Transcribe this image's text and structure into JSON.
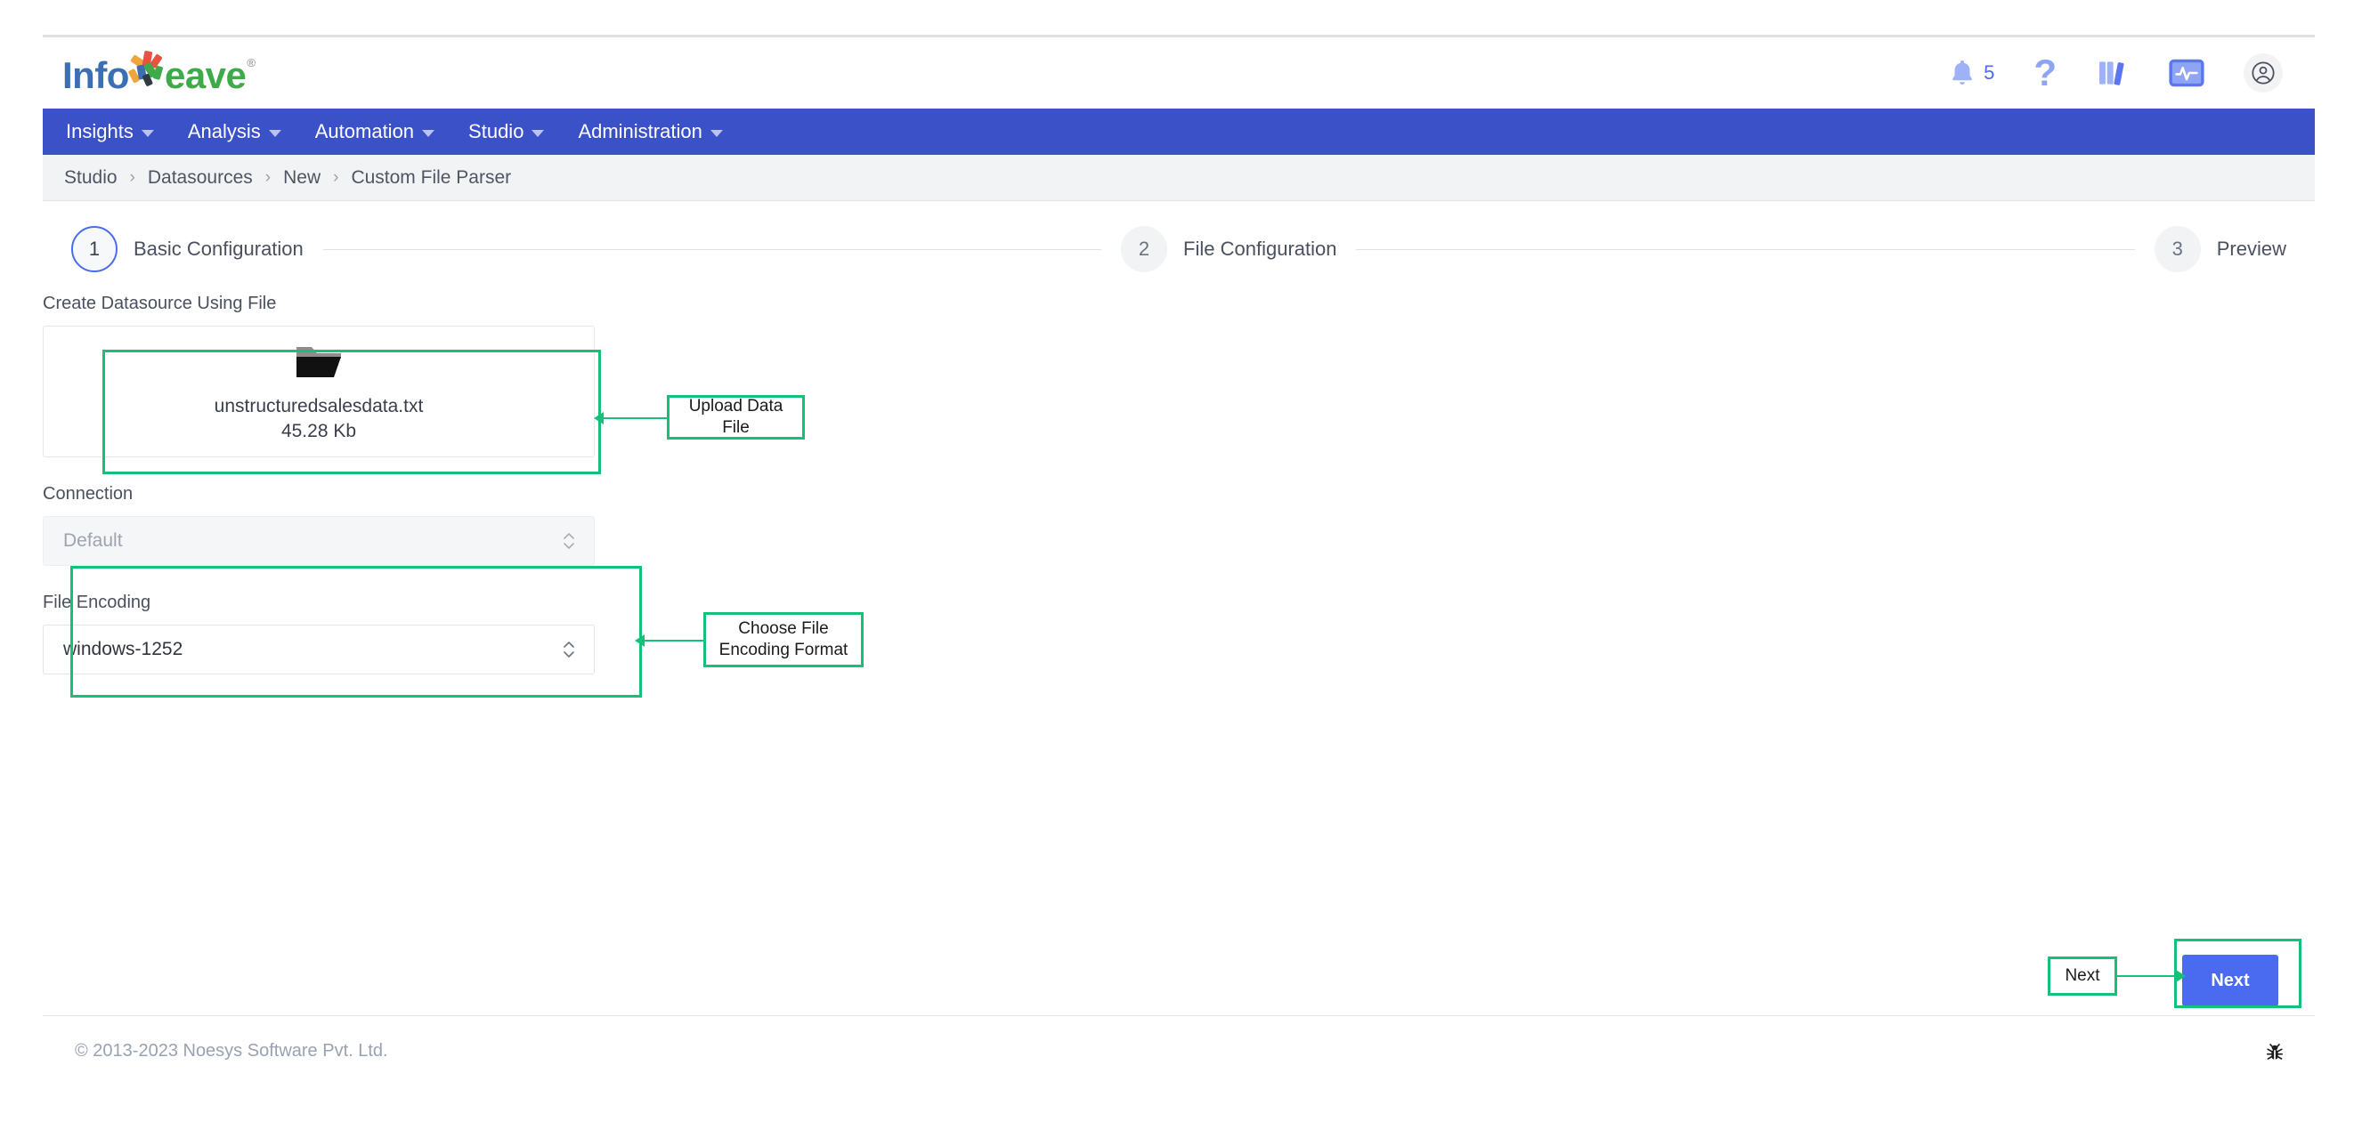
{
  "brand": {
    "name_part1": "Info",
    "name_part2": "eave",
    "registered": "®",
    "nav_color": "#3b51c8",
    "accent_color": "#4a6bf0",
    "annotation_color": "#17c07a"
  },
  "header": {
    "icons": [
      {
        "name": "notifications-icon",
        "glyph": "bell",
        "badge": "5"
      },
      {
        "name": "help-icon",
        "glyph": "?"
      },
      {
        "name": "library-icon",
        "glyph": "books"
      },
      {
        "name": "monitor-icon",
        "glyph": "monitor"
      },
      {
        "name": "user-account-icon",
        "glyph": "avatar"
      }
    ]
  },
  "nav": {
    "items": [
      {
        "label": "Insights"
      },
      {
        "label": "Analysis"
      },
      {
        "label": "Automation"
      },
      {
        "label": "Studio"
      },
      {
        "label": "Administration"
      }
    ]
  },
  "breadcrumb": {
    "separator": "›",
    "items": [
      {
        "label": "Studio"
      },
      {
        "label": "Datasources"
      },
      {
        "label": "New"
      },
      {
        "label": "Custom File Parser"
      }
    ]
  },
  "stepper": {
    "steps": [
      {
        "number": "1",
        "label": "Basic Configuration",
        "state": "active"
      },
      {
        "number": "2",
        "label": "File Configuration",
        "state": "inactive"
      },
      {
        "number": "3",
        "label": "Preview",
        "state": "inactive"
      }
    ]
  },
  "form": {
    "upload": {
      "label": "Create Datasource Using File",
      "file_name": "unstructuredsalesdata.txt",
      "file_size": "45.28 Kb"
    },
    "connection": {
      "label": "Connection",
      "value": "Default",
      "disabled": true
    },
    "file_encoding": {
      "label": "File Encoding",
      "value": "windows-1252"
    }
  },
  "annotations": [
    {
      "text": "Upload Data File"
    },
    {
      "text": "Choose File\nEncoding Format"
    },
    {
      "text": "Next"
    }
  ],
  "actions": {
    "next_label": "Next"
  },
  "footer": {
    "copyright": "© 2013-2023 Noesys Software Pvt. Ltd.",
    "debug_icon": "bug-icon"
  }
}
